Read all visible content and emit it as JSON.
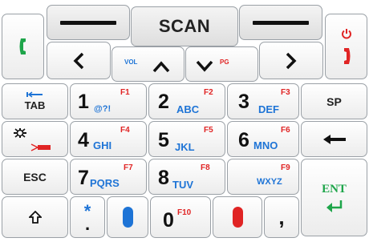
{
  "top_row": {
    "scan_label": "SCAN"
  },
  "nav_row": {
    "vol_label": "VOL",
    "pg_label": "PG"
  },
  "side_keys": {
    "tab_label": "TAB",
    "esc_label": "ESC",
    "sp_label": "SP",
    "ent_label": "ENT"
  },
  "number_keys": [
    {
      "digit": "1",
      "letters": "@?!",
      "fn": "F1"
    },
    {
      "digit": "2",
      "letters": "ABC",
      "fn": "F2"
    },
    {
      "digit": "3",
      "letters": "DEF",
      "fn": "F3"
    },
    {
      "digit": "4",
      "letters": "GHI",
      "fn": "F4"
    },
    {
      "digit": "5",
      "letters": "JKL",
      "fn": "F5"
    },
    {
      "digit": "6",
      "letters": "MNO",
      "fn": "F6"
    },
    {
      "digit": "7",
      "letters": "PQRS",
      "fn": "F7"
    },
    {
      "digit": "8",
      "letters": "TUV",
      "fn": "F8"
    },
    {
      "digit": "",
      "letters": "WXYZ",
      "fn": "F9"
    },
    {
      "digit": "0",
      "letters": "",
      "fn": "F10"
    }
  ],
  "bottom_row": {
    "star_label": "*",
    "dot_label": ".",
    "comma_label": ","
  },
  "colors": {
    "blue": "#1e74d6",
    "red": "#e02424",
    "green": "#1ea54a",
    "dark": "#111111"
  },
  "icons": [
    "call-icon",
    "power-icon",
    "end-call-icon",
    "left-arrow-icon",
    "up-arrow-icon",
    "down-arrow-icon",
    "right-arrow-icon",
    "tab-icon",
    "backlight-icon",
    "laser-icon",
    "backspace-icon",
    "enter-icon",
    "shift-icon",
    "blue-key-icon",
    "red-key-icon"
  ]
}
